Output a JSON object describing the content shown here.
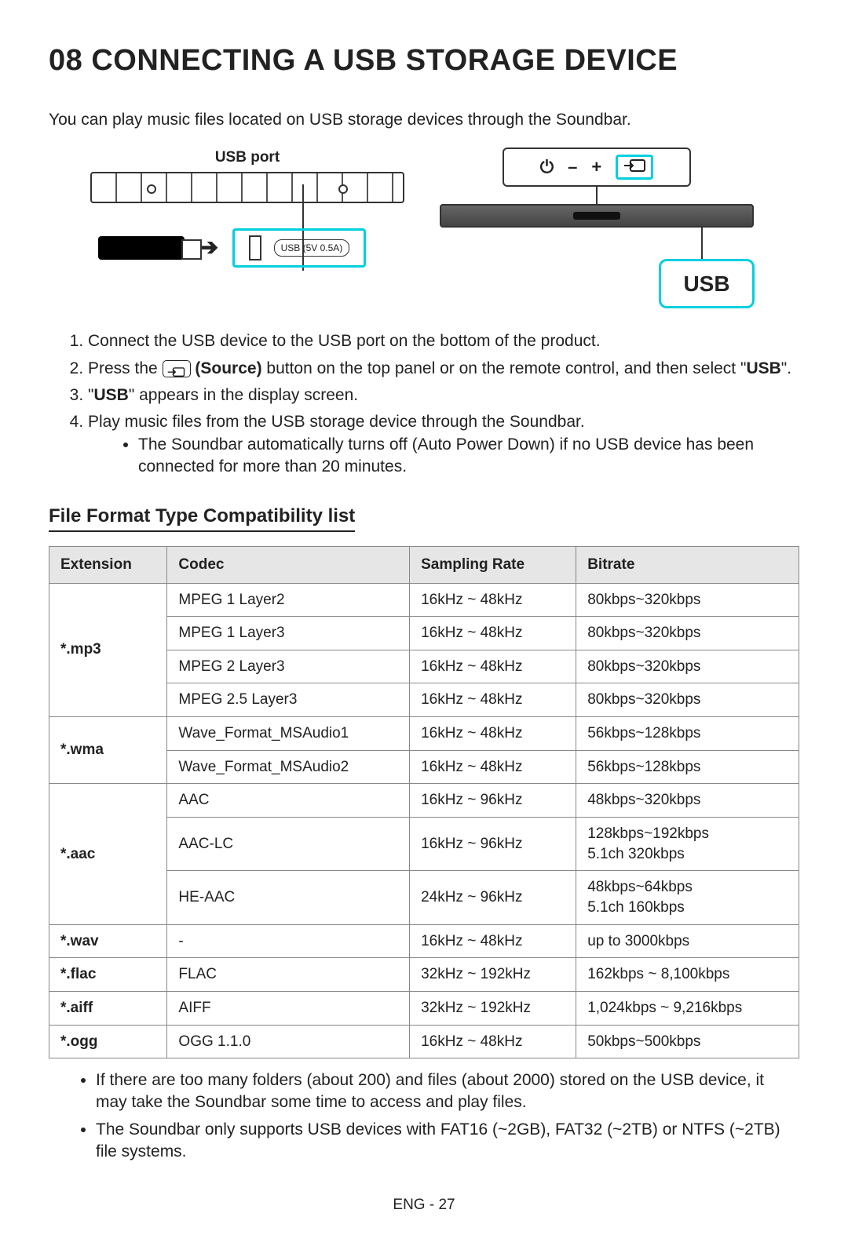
{
  "title": "08 CONNECTING A USB STORAGE DEVICE",
  "intro": "You can play music files located on USB storage devices through the Soundbar.",
  "diagram": {
    "usb_port_label": "USB port",
    "usb_port_badge": "USB (5V 0.5A)",
    "panel_power": "⏻",
    "panel_minus": "–",
    "panel_plus": "+",
    "usb_bubble": "USB"
  },
  "steps": {
    "s1": "Connect the USB device to the USB port on the bottom of the product.",
    "s2_a": "Press the ",
    "s2_b": " (Source)",
    "s2_c": " button on the top panel or on the remote control, and then select \"",
    "s2_d": "USB",
    "s2_e": "\".",
    "s3_a": "\"",
    "s3_b": "USB",
    "s3_c": "\" appears in the display screen.",
    "s4": "Play music files from the USB storage device through the Soundbar.",
    "s4_sub": "The Soundbar automatically turns off (Auto Power Down) if no USB device has been connected for more than 20 minutes."
  },
  "table_heading": "File Format Type Compatibility list",
  "table": {
    "headers": {
      "ext": "Extension",
      "codec": "Codec",
      "rate": "Sampling Rate",
      "bitrate": "Bitrate"
    },
    "rows": [
      {
        "ext": "*.mp3",
        "codec": "MPEG 1 Layer2",
        "rate": "16kHz ~ 48kHz",
        "bitrate": "80kbps~320kbps"
      },
      {
        "ext": "",
        "codec": "MPEG 1 Layer3",
        "rate": "16kHz ~ 48kHz",
        "bitrate": "80kbps~320kbps"
      },
      {
        "ext": "",
        "codec": "MPEG 2 Layer3",
        "rate": "16kHz ~ 48kHz",
        "bitrate": "80kbps~320kbps"
      },
      {
        "ext": "",
        "codec": "MPEG 2.5 Layer3",
        "rate": "16kHz ~ 48kHz",
        "bitrate": "80kbps~320kbps"
      },
      {
        "ext": "*.wma",
        "codec": "Wave_Format_MSAudio1",
        "rate": "16kHz ~ 48kHz",
        "bitrate": "56kbps~128kbps"
      },
      {
        "ext": "",
        "codec": "Wave_Format_MSAudio2",
        "rate": "16kHz ~ 48kHz",
        "bitrate": "56kbps~128kbps"
      },
      {
        "ext": "*.aac",
        "codec": "AAC",
        "rate": "16kHz ~ 96kHz",
        "bitrate": "48kbps~320kbps"
      },
      {
        "ext": "",
        "codec": "AAC-LC",
        "rate": "16kHz ~ 96kHz",
        "bitrate": "128kbps~192kbps\n5.1ch 320kbps"
      },
      {
        "ext": "",
        "codec": "HE-AAC",
        "rate": "24kHz ~ 96kHz",
        "bitrate": "48kbps~64kbps\n5.1ch 160kbps"
      },
      {
        "ext": "*.wav",
        "codec": "-",
        "rate": "16kHz ~ 48kHz",
        "bitrate": "up to 3000kbps"
      },
      {
        "ext": "*.flac",
        "codec": "FLAC",
        "rate": "32kHz ~ 192kHz",
        "bitrate": "162kbps ~ 8,100kbps"
      },
      {
        "ext": "*.aiff",
        "codec": "AIFF",
        "rate": "32kHz ~ 192kHz",
        "bitrate": "1,024kbps ~ 9,216kbps"
      },
      {
        "ext": "*.ogg",
        "codec": "OGG 1.1.0",
        "rate": "16kHz ~ 48kHz",
        "bitrate": "50kbps~500kbps"
      }
    ]
  },
  "notes": {
    "n1": "If there are too many folders (about 200) and files (about 2000) stored on the USB device, it may take the Soundbar some time to access and play files.",
    "n2": "The Soundbar only supports USB devices with FAT16 (~2GB), FAT32 (~2TB) or NTFS (~2TB) file systems."
  },
  "footer": "ENG - 27"
}
